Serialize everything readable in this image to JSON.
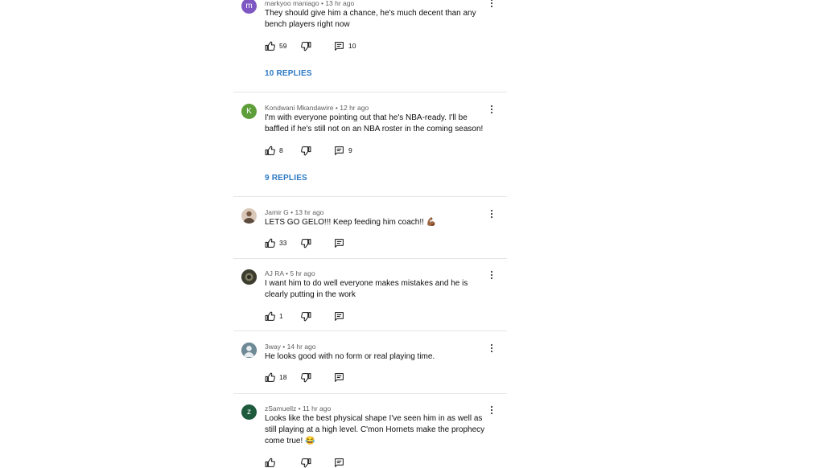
{
  "comments": [
    {
      "author": "markyoo maniago",
      "time": "13 hr ago",
      "avatar_letter": "m",
      "avatar_color": "#7e57c2",
      "text": "They should give him a chance, he's much decent than any bench players right now",
      "likes": "59",
      "reply_count": "10",
      "replies_label": "10 REPLIES"
    },
    {
      "author": "Kondwani Mkandawire",
      "time": "12 hr ago",
      "avatar_letter": "K",
      "avatar_color": "#5e9e3a",
      "text": "I'm with everyone pointing out that he's NBA-ready.  I'll be baffled if he's still not on an NBA roster in the coming season!",
      "likes": "8",
      "reply_count": "9",
      "replies_label": "9 REPLIES"
    },
    {
      "author": "Jamir G",
      "time": "13 hr ago",
      "avatar_letter": "",
      "avatar_color": "#d9c7b8",
      "text": "LETS GO GELO!!! Keep feeding him coach!! 💪🏾",
      "likes": "33",
      "reply_count": ""
    },
    {
      "author": "AJ RA",
      "time": "5 hr ago",
      "avatar_letter": "",
      "avatar_color": "#4a4a3a",
      "text": "I want him to do well everyone makes mistakes and he is clearly putting in the work",
      "likes": "1",
      "reply_count": ""
    },
    {
      "author": "3way",
      "time": "14 hr ago",
      "avatar_letter": "",
      "avatar_color": "#5f7c8a",
      "text": "He looks good with no form or real playing time.",
      "likes": "18",
      "reply_count": ""
    },
    {
      "author": "zSamuellz",
      "time": "11 hr ago",
      "avatar_letter": "z",
      "avatar_color": "#1e5a3c",
      "text": "Looks like the best physical shape I've seen him in as well as still playing at a high level. C'mon Hornets make the prophecy come true! 😂",
      "likes": "",
      "reply_count": ""
    }
  ],
  "separator": "•",
  "icons": [
    "like-icon",
    "dislike-icon",
    "reply-icon",
    "more-icon"
  ]
}
